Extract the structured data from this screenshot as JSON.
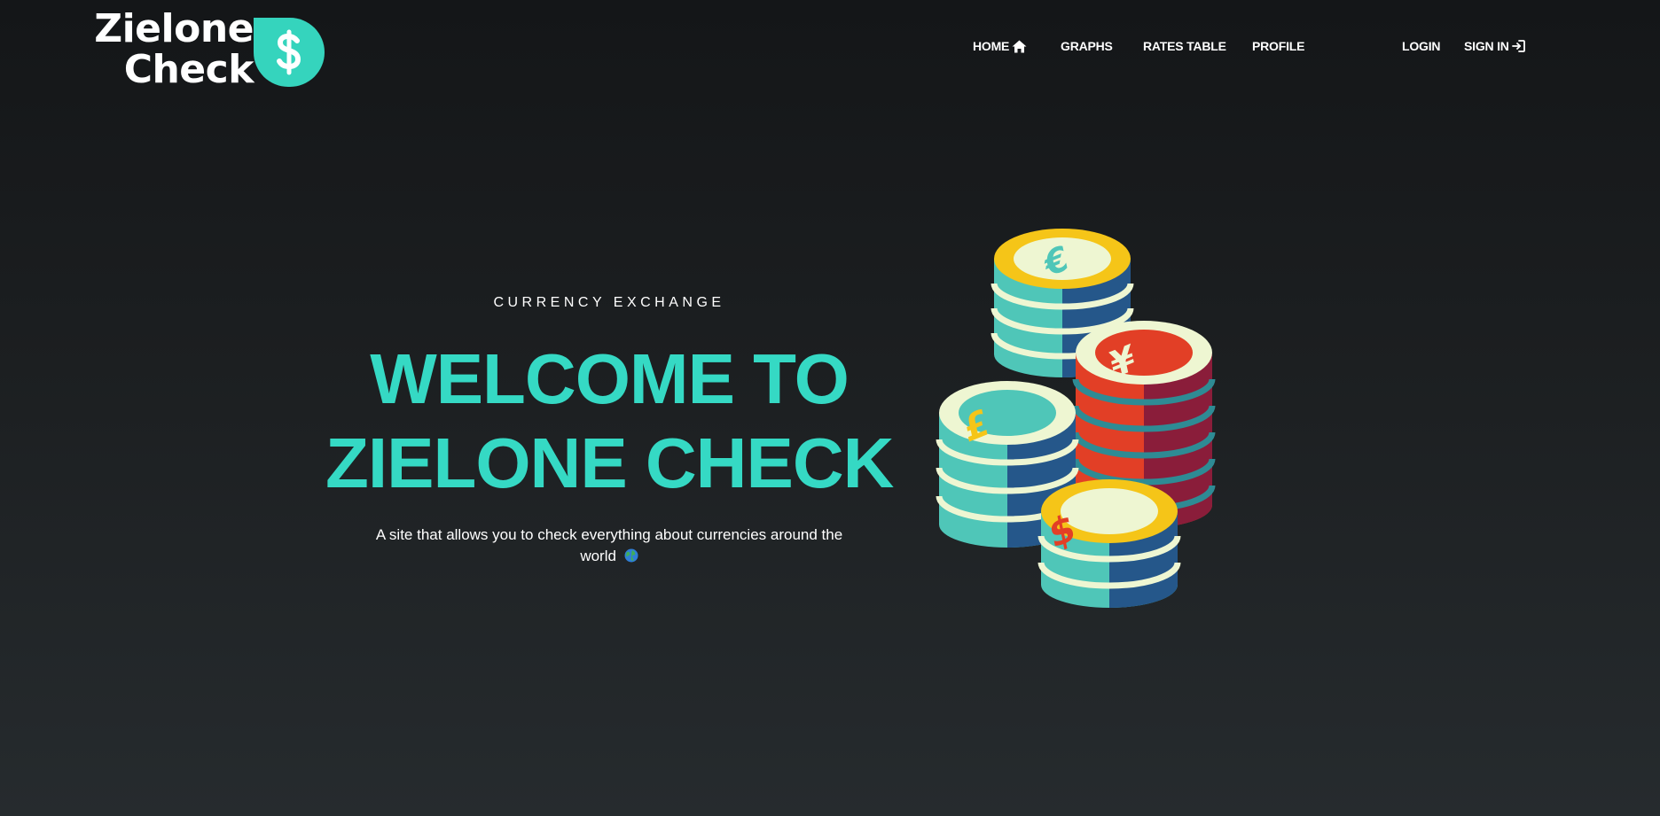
{
  "brand": {
    "line1": "Zielone",
    "line2": "Check",
    "badge_symbol": "$",
    "accent": "#35d4bd"
  },
  "nav": {
    "home": "HOME",
    "graphs": "GRAPHS",
    "rates_table": "RATES TABLE",
    "profile": "PROFILE",
    "login": "LOGIN",
    "sign_in": "SIGN IN"
  },
  "hero": {
    "kicker": "CURRENCY EXCHANGE",
    "title_line1": "WELCOME TO",
    "title_line2": "ZIELONE CHECK",
    "description": "A site that allows you to check everything about currencies around the world",
    "globe_icon": "globe-icon",
    "title_color": "#35d9c4"
  },
  "illustration": {
    "coins": [
      "€",
      "¥",
      "£",
      "$"
    ]
  },
  "colors": {
    "background_top": "#141618",
    "background_bottom": "#262b2e",
    "teal": "#4fc6b8",
    "navy": "#25578a",
    "gold": "#f5c518",
    "red": "#e23f26",
    "cream": "#eef6d2",
    "maroon": "#8a1d3a"
  }
}
